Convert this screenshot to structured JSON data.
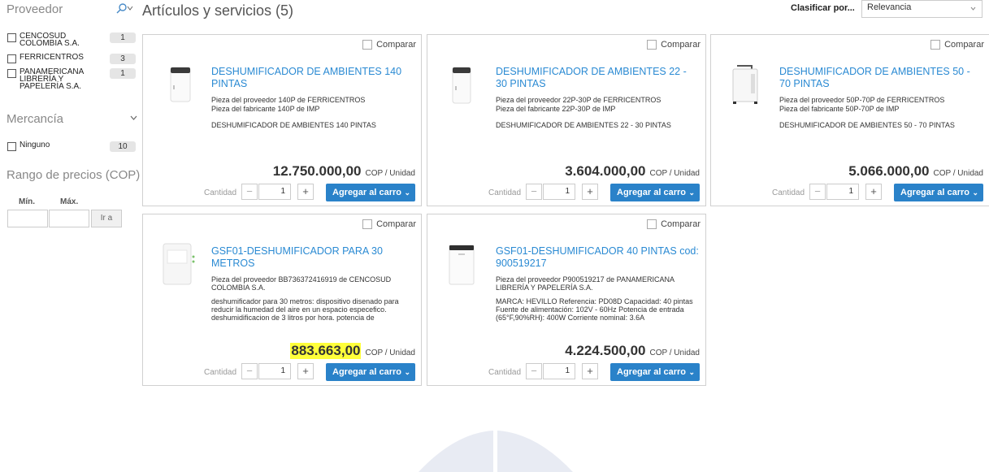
{
  "sidebar": {
    "supplier_heading": "Proveedor",
    "suppliers": [
      {
        "name": "CENCOSUD COLOMBIA S.A.",
        "count": "1"
      },
      {
        "name": "FERRICENTROS",
        "count": "3"
      },
      {
        "name": "PANAMERICANA LIBRERÍA Y PAPELERÍA S.A.",
        "count": "1"
      }
    ],
    "merch_heading": "Mercancía",
    "merch": [
      {
        "name": "Ninguno",
        "count": "10"
      }
    ],
    "price_heading": "Rango de precios (COP)",
    "min_label": "Mín.",
    "max_label": "Máx.",
    "go_label": "Ir a"
  },
  "header": {
    "title": "Artículos y servicios (5)",
    "sort_label": "Clasificar por...",
    "sort_value": "Relevancia"
  },
  "common": {
    "compare_label": "Comparar",
    "qty_label": "Cantidad",
    "cart_label": "Agregar al carro",
    "qty_value": "1",
    "unit": "COP / Unidad"
  },
  "products": [
    {
      "title": "DESHUMIFICADOR DE AMBIENTES 140 PINTAS",
      "supplier_part": "Pieza del proveedor 140P de FERRICENTROS",
      "mfr_part": "Pieza del fabricante 140P de IMP",
      "desc": "DESHUMIFICADOR DE AMBIENTES 140 PINTAS",
      "price": "12.750.000,00",
      "highlight": false
    },
    {
      "title": "DESHUMIFICADOR DE AMBIENTES 22 - 30 PINTAS",
      "supplier_part": "Pieza del proveedor 22P-30P de FERRICENTROS",
      "mfr_part": "Pieza del fabricante 22P-30P de IMP",
      "desc": "DESHUMIFICADOR DE AMBIENTES 22 - 30 PINTAS",
      "price": "3.604.000,00",
      "highlight": false
    },
    {
      "title": "DESHUMIFICADOR DE AMBIENTES 50 - 70 PINTAS",
      "supplier_part": "Pieza del proveedor 50P-70P de FERRICENTROS",
      "mfr_part": "Pieza del fabricante 50P-70P de IMP",
      "desc": "DESHUMIFICADOR DE AMBIENTES 50 - 70 PINTAS",
      "price": "5.066.000,00",
      "highlight": false
    },
    {
      "title": "GSF01-DESHUMIFICADOR PARA 30 METROS",
      "supplier_part": "Pieza del proveedor BB736372416919 de CENCOSUD COLOMBIA S.A.",
      "mfr_part": "",
      "desc": "deshumificador para 30 metros: dispositivo disenado para reducir la humedad del aire en un espacio especefico. deshumidificacion de 3 litros por hora. potencia de",
      "price": "883.663,00",
      "highlight": true
    },
    {
      "title": "GSF01-DESHUMIFICADOR 40 PINTAS cod: 900519217",
      "supplier_part": "Pieza del proveedor P900519217 de PANAMERICANA LIBRERÍA Y PAPELERÍA S.A.",
      "mfr_part": "",
      "desc": "MARCA: HEVILLO Referencia: PD08D Capacidad: 40 pintas Fuente de alimentación: 102V - 60Hz Potencia de entrada (65°F,90%RH): 400W Corriente nominal: 3.6A",
      "price": "4.224.500,00",
      "highlight": false
    }
  ]
}
